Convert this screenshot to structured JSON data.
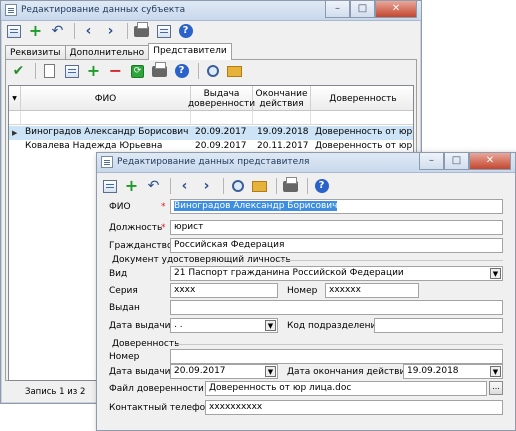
{
  "main_window": {
    "title": "Редактирование данных субъекта",
    "tabs": [
      "Реквизиты",
      "Дополнительно",
      "Представители"
    ],
    "active_tab": 2,
    "grid": {
      "columns": [
        "ФИО",
        "Выдача доверенности",
        "Окончание действия",
        "Доверенность"
      ],
      "rows": [
        [
          "Виноградов Александр Борисович",
          "20.09.2017",
          "19.09.2018",
          "Доверенность от юр лица.doc"
        ],
        [
          "Ковалева Надежда Юрьевна",
          "20.09.2017",
          "20.11.2017",
          "Доверенность от юр лица.pdf"
        ]
      ],
      "selected_row": 0
    },
    "status": "Запись 1 из 2"
  },
  "dialog": {
    "title": "Редактирование данных представителя",
    "labels": {
      "fio": "ФИО",
      "position": "Должность",
      "citizenship": "Гражданство",
      "id_doc_section": "Документ удостоверяющий личность",
      "type": "Вид",
      "series": "Серия",
      "number": "Номер",
      "issued_by": "Выдан",
      "issue_date": "Дата выдачи",
      "division_code": "Код подразделения",
      "poa_section": "Доверенность",
      "poa_number": "Номер",
      "poa_issue_date": "Дата выдачи",
      "poa_end_date": "Дата окончания действия",
      "poa_file": "Файл доверенности",
      "phone": "Контактный телефон"
    },
    "values": {
      "fio": "Виноградов Александр Борисович",
      "position": "юрист",
      "citizenship": "Российская Федерация",
      "type": "21 Паспорт гражданина Российской Федерации",
      "series": "хххх",
      "number": "хххххх",
      "issued_by": "",
      "issue_date": " .  .",
      "division_code": "",
      "poa_number": "",
      "poa_issue_date": "20.09.2017",
      "poa_end_date": "19.09.2018",
      "poa_file": "Доверенность от юр лица.doc",
      "phone": "хххххххххх"
    },
    "required_mark": "*",
    "browse_label": "..."
  },
  "colors": {
    "selection": "#cde4f7",
    "required": "#e0151a",
    "titlebar": "#c8d8ec"
  }
}
